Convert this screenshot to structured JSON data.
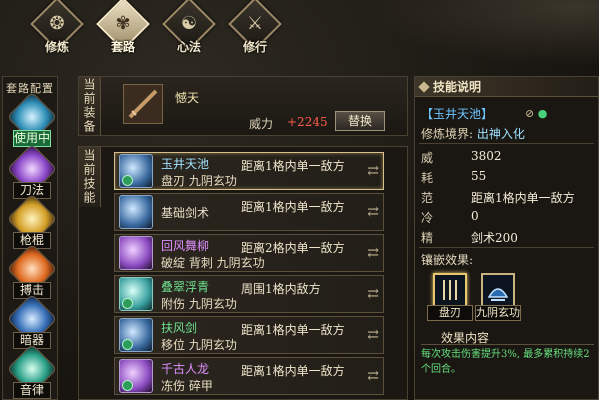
{
  "nav": [
    {
      "label": "修炼",
      "icon": "cultivate-icon",
      "glyph": "❂",
      "active": false
    },
    {
      "label": "套路",
      "icon": "routine-icon",
      "glyph": "✾",
      "active": true
    },
    {
      "label": "心法",
      "icon": "mind-method-icon",
      "glyph": "☯",
      "active": false
    },
    {
      "label": "修行",
      "icon": "practice-icon",
      "glyph": "⚔",
      "active": false
    }
  ],
  "left": {
    "title": "套路配置",
    "items": [
      {
        "label": "使用中",
        "state": "using"
      },
      {
        "label": "刀法"
      },
      {
        "label": "枪棍"
      },
      {
        "label": "搏击"
      },
      {
        "label": "暗器"
      },
      {
        "label": "音律"
      }
    ]
  },
  "equip": {
    "side_label": "当前装备",
    "weapon_name": "憾天",
    "power_label": "威力",
    "power_value": "+2245",
    "replace_label": "替换"
  },
  "skills": {
    "side_label": "当前技能",
    "rows": [
      {
        "name": "玉井天池",
        "sub": "盘刃  九阴玄功",
        "range": "距离1格内单一敌方",
        "color": "blue",
        "badge": true
      },
      {
        "name": "基础剑术",
        "sub": "",
        "range": "距离1格内单一敌方",
        "color": "blue",
        "badge": false
      },
      {
        "name": "回风舞柳",
        "sub": "破绽  背刺  九阴玄功",
        "range": "距离2格内单一敌方",
        "color": "purple",
        "badge": false
      },
      {
        "name": "叠翠浮青",
        "sub": "附伤  九阴玄功",
        "range": "周围1格内敌方",
        "color": "green",
        "badge": true
      },
      {
        "name": "扶风剑",
        "sub": "移位  九阴玄功",
        "range": "距离1格内单一敌方",
        "color": "green",
        "badge": true
      },
      {
        "name": "千古人龙",
        "sub": "冻伤  碎甲",
        "range": "距离1格内单一敌方",
        "color": "purple",
        "badge": true
      }
    ]
  },
  "detail": {
    "title": "技能说明",
    "skill_name": "【玉井天池】",
    "realm_key": "修炼境界:",
    "realm_value": "出神入化",
    "stats": [
      {
        "k": "威",
        "v": "3802"
      },
      {
        "k": "耗",
        "v": "55"
      },
      {
        "k": "范",
        "v": "距离1格内单一敌方"
      },
      {
        "k": "冷",
        "v": "0"
      },
      {
        "k": "精",
        "v": "剑术200"
      }
    ],
    "inlay_title": "镶嵌效果:",
    "inlays": [
      {
        "label": "盘刃"
      },
      {
        "label": "九阴玄功"
      }
    ],
    "effect_title": "效果内容",
    "effect_text": "每次攻击伤害提升3%, 最多累积持续2个回合。"
  }
}
